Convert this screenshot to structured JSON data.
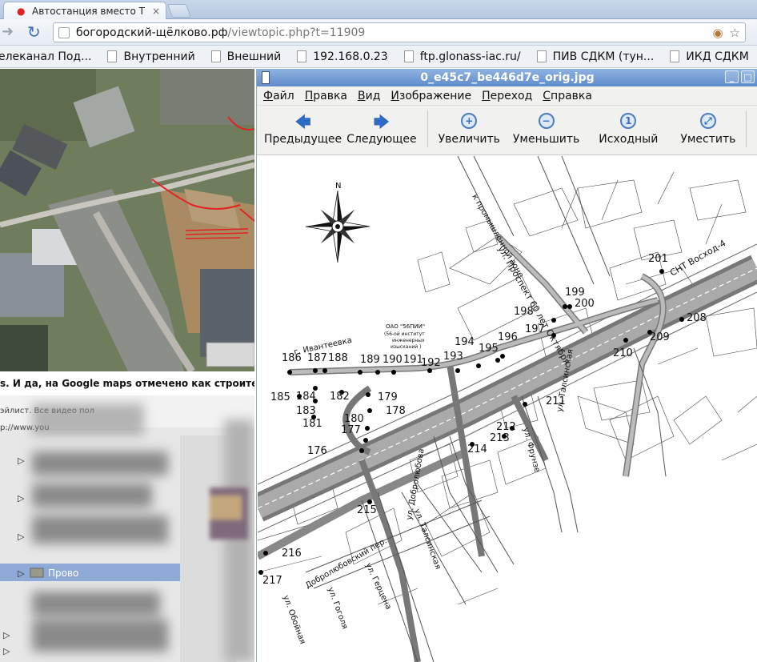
{
  "browser": {
    "tab_title": "Автостанция вместо Т",
    "url_host": "богородский-щёлково.рф",
    "url_path": "/viewtopic.php?t=11909",
    "bookmarks": [
      "елеканал Под...",
      "Внутренний",
      "Внешний",
      "192.168.0.23",
      "ftp.glonass-iac.ru/",
      "ПИВ СДКМ (тун...",
      "ИКД СДКМ"
    ]
  },
  "webpage": {
    "forum_text": "s. И да, на Google maps отмечено как строительс",
    "playlist_text": "эйлист. Все видео пол",
    "link_text": "p://www.you",
    "folder_label": "Прово"
  },
  "viewer": {
    "title": "0_e45c7_be446d7e_orig.jpg",
    "menu": [
      "Файл",
      "Правка",
      "Вид",
      "Изображение",
      "Переход",
      "Справка"
    ],
    "toolbar": {
      "prev": "Предыдущее",
      "next": "Следующее",
      "zoom_in": "Увеличить",
      "zoom_out": "Уменьшить",
      "original": "Исходный",
      "fit": "Уместить"
    }
  },
  "map": {
    "compass_n": "N",
    "labels": {
      "industrial": "к промышленной зоне",
      "prospekt": "ул. Проспект 60 лет Октября",
      "snt": "СНТ Восход-4",
      "ivanteevka": "г. Ивантеевка",
      "institute": "ОАО \"56ПИИ\"",
      "institute2": "(56-ой институт",
      "institute3": "инженерных",
      "institute4": "изысканий )",
      "frunze": "ул. Фрунзе",
      "talsinskaya": "ул. Талсинская",
      "talsinskaya2": "ул. Талсинская",
      "dobrolyubova": "ул. Добролюбова",
      "dobrolyubovsky": "Добролюбовский пер.",
      "gertsena": "ул. Герцена",
      "gogolya": "ул. Гоголя",
      "oboynaya": "ул. Обойная"
    },
    "stops": [
      "176",
      "177",
      "178",
      "179",
      "180",
      "181",
      "182",
      "183",
      "184",
      "185",
      "186",
      "187",
      "188",
      "189",
      "190",
      "191",
      "192",
      "193",
      "194",
      "195",
      "196",
      "197",
      "198",
      "199",
      "200",
      "201",
      "208",
      "209",
      "210",
      "211",
      "212",
      "213",
      "214",
      "215",
      "216",
      "217"
    ]
  }
}
